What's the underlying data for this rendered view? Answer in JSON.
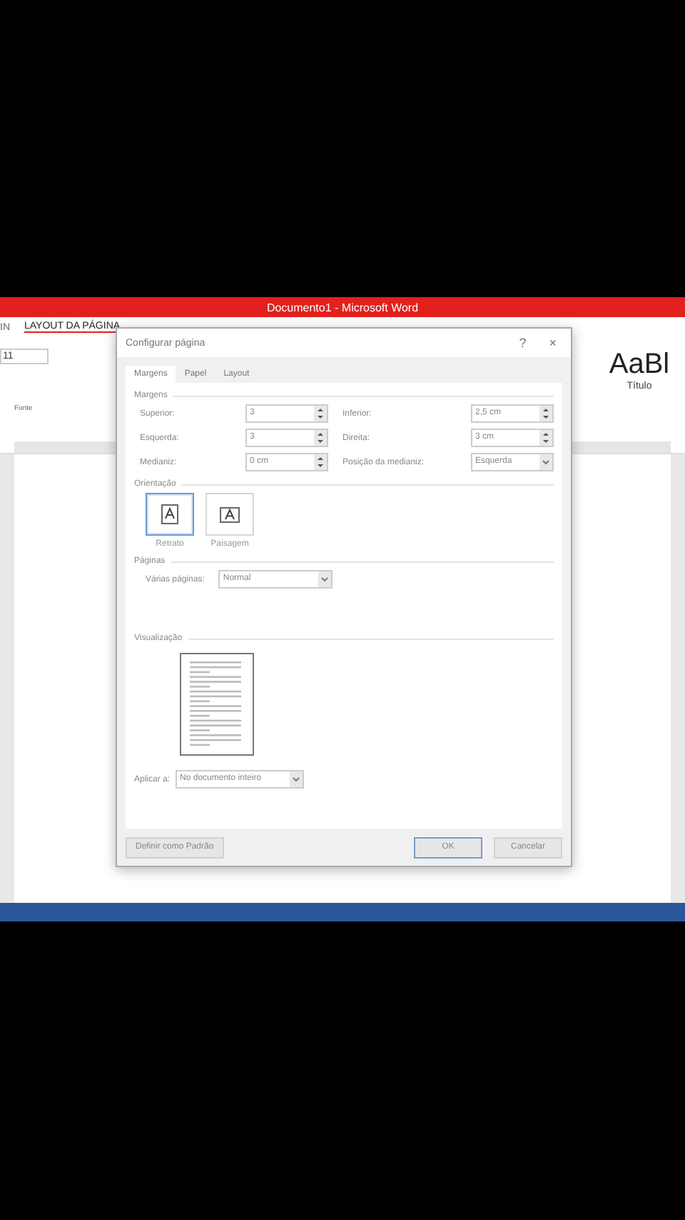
{
  "window": {
    "title": "Documento1 -  Microsoft Word"
  },
  "ribbon": {
    "tabs": [
      {
        "label": "IN",
        "selected": false
      },
      {
        "label": "LAYOUT DA PÁGINA",
        "selected": true
      }
    ],
    "font_size": "11",
    "group_label": "Fonte",
    "styles": [
      {
        "sample": "AaBl",
        "name": "Título"
      }
    ]
  },
  "dialog": {
    "title": "Configurar página",
    "help": "?",
    "close": "×",
    "tabs": [
      {
        "label": "Margens",
        "selected": true
      },
      {
        "label": "Papel",
        "selected": false
      },
      {
        "label": "Layout",
        "selected": false
      }
    ],
    "margins": {
      "heading": "Margens",
      "fields": [
        {
          "label": "Superior:",
          "value": "3",
          "kind": "spin"
        },
        {
          "label": "Inferior:",
          "value": "2,5 cm",
          "kind": "spin"
        },
        {
          "label": "Esquerda:",
          "value": "3",
          "kind": "spin"
        },
        {
          "label": "Direita:",
          "value": "3 cm",
          "kind": "spin"
        },
        {
          "label": "Medianiz:",
          "value": "0 cm",
          "kind": "spin"
        },
        {
          "label": "Posição da medianiz:",
          "value": "Esquerda",
          "kind": "select"
        }
      ]
    },
    "orientation": {
      "heading": "Orientação",
      "options": [
        {
          "label": "Retrato",
          "selected": true
        },
        {
          "label": "Paisagem",
          "selected": false
        }
      ]
    },
    "pages": {
      "heading": "Páginas",
      "label": "Várias páginas:",
      "value": "Normal"
    },
    "preview": {
      "heading": "Visualização"
    },
    "apply": {
      "label": "Aplicar a:",
      "value": "No documento inteiro"
    },
    "buttons": {
      "default": "Definir como Padrão",
      "ok": "OK",
      "cancel": "Cancelar"
    }
  }
}
